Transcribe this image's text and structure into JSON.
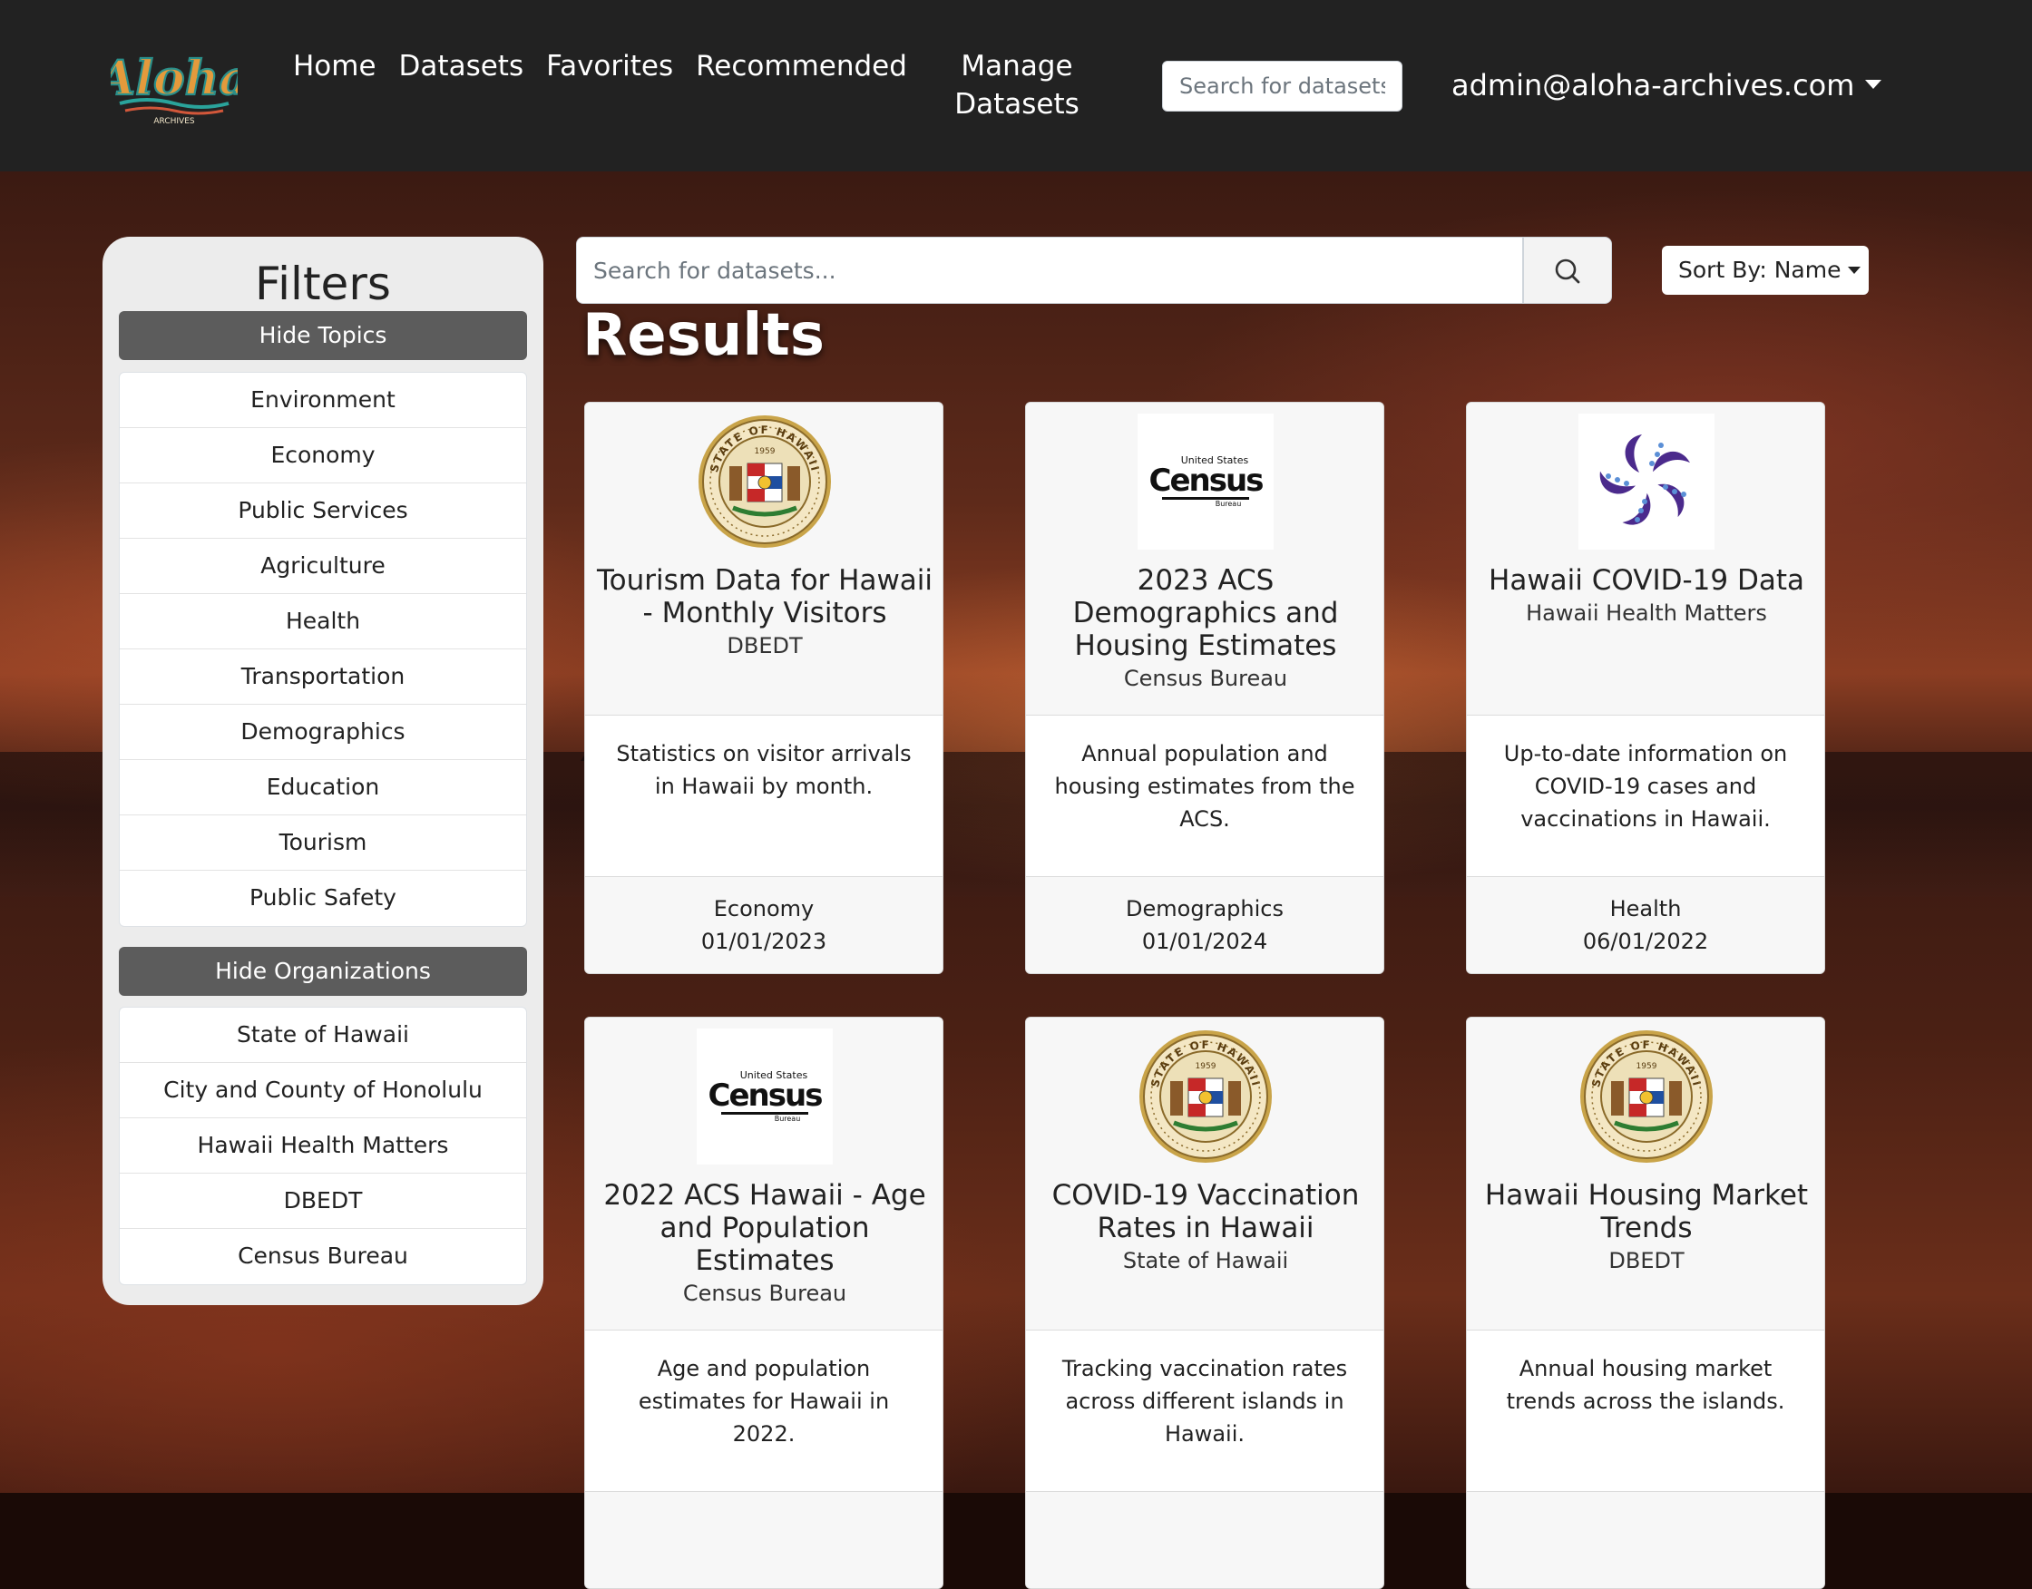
{
  "nav": {
    "brand": "Aloha",
    "brand_sub": "ARCHIVES",
    "links": [
      "Home",
      "Datasets",
      "Favorites",
      "Recommended"
    ],
    "manage_line1": "Manage",
    "manage_line2": "Datasets",
    "search_placeholder": "Search for datasets",
    "user_email": "admin@aloha-archives.com"
  },
  "filters": {
    "title": "Filters",
    "hide_topics_label": "Hide Topics",
    "topics": [
      "Environment",
      "Economy",
      "Public Services",
      "Agriculture",
      "Health",
      "Transportation",
      "Demographics",
      "Education",
      "Tourism",
      "Public Safety"
    ],
    "hide_orgs_label": "Hide Organizations",
    "organizations": [
      "State of Hawaii",
      "City and County of Honolulu",
      "Hawaii Health Matters",
      "DBEDT",
      "Census Bureau"
    ]
  },
  "search": {
    "placeholder": "Search for datasets...",
    "sort_label": "Sort By: Name"
  },
  "results": {
    "title": "Results",
    "cards": [
      {
        "logo": "state-seal",
        "title": "Tourism Data for Hawaii - Monthly Visitors",
        "org": "DBEDT",
        "description": "Statistics on visitor arrivals in Hawaii by month.",
        "topic": "Economy",
        "date": "01/01/2023"
      },
      {
        "logo": "census",
        "title": "2023 ACS Demographics and Housing Estimates",
        "org": "Census Bureau",
        "description": "Annual population and housing estimates from the ACS.",
        "topic": "Demographics",
        "date": "01/01/2024"
      },
      {
        "logo": "covid-flower",
        "title": "Hawaii COVID-19 Data",
        "org": "Hawaii Health Matters",
        "description": "Up-to-date information on COVID-19 cases and vaccinations in Hawaii.",
        "topic": "Health",
        "date": "06/01/2022"
      },
      {
        "logo": "census",
        "title": "2022 ACS Hawaii - Age and Population Estimates",
        "org": "Census Bureau",
        "description": "Age and population estimates for Hawaii in 2022.",
        "topic": "",
        "date": ""
      },
      {
        "logo": "state-seal",
        "title": "COVID-19 Vaccination Rates in Hawaii",
        "org": "State of Hawaii",
        "description": "Tracking vaccination rates across different islands in Hawaii.",
        "topic": "",
        "date": ""
      },
      {
        "logo": "state-seal",
        "title": "Hawaii Housing Market Trends",
        "org": "DBEDT",
        "description": "Annual housing market trends across the islands.",
        "topic": "",
        "date": ""
      }
    ]
  },
  "census_logo": {
    "top": "United States",
    "name": "Census",
    "bottom": "Bureau"
  },
  "seal_text": {
    "top": "STATE OF HAWAII",
    "year": "1959"
  },
  "colors": {
    "navbar_bg": "#222222",
    "toggle_bg": "#5c5c5c",
    "covid_purple": "#4b2a8c",
    "seal_gold": "#c9a449"
  }
}
